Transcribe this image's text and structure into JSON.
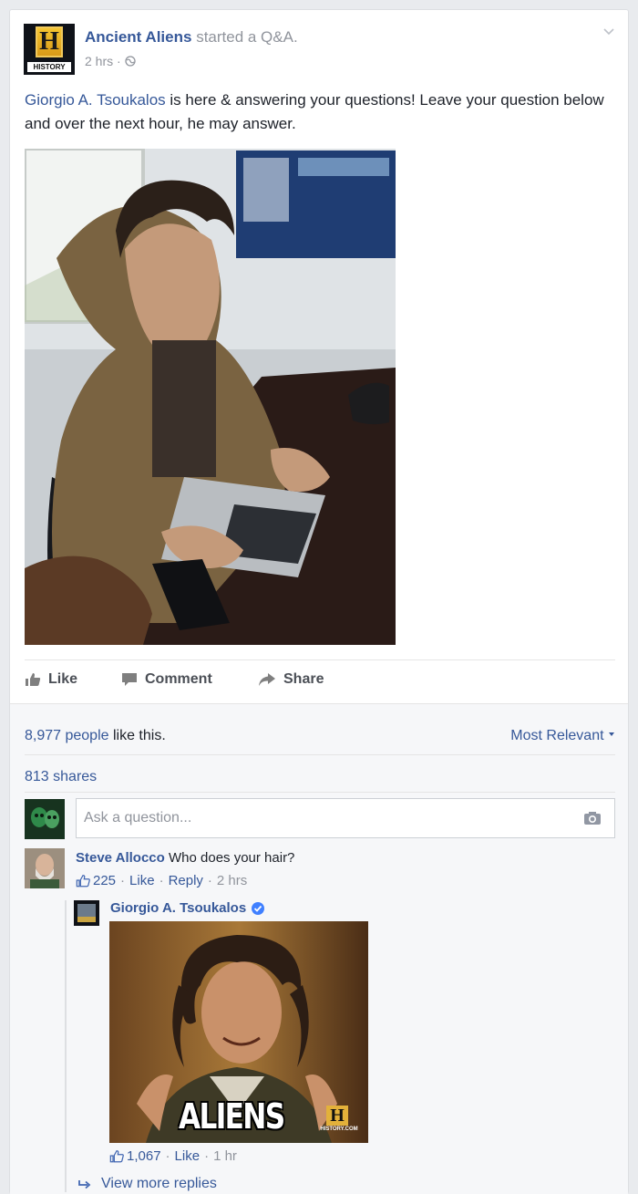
{
  "post": {
    "page_name": "Ancient Aliens",
    "verb": "started a Q&A.",
    "time": "2 hrs",
    "logo_text": "H",
    "logo_sub": "HISTORY",
    "mention": "Giorgio A. Tsoukalos",
    "body": " is here & answering your questions! Leave your question below and over the next hour, he may answer."
  },
  "actions": {
    "like": "Like",
    "comment": "Comment",
    "share": "Share"
  },
  "stats": {
    "likes_count": "8,977 people",
    "likes_suffix": " like this.",
    "sort_label": "Most Relevant",
    "shares": "813 shares"
  },
  "composer": {
    "placeholder": "Ask a question..."
  },
  "comment": {
    "author": "Steve Allocco",
    "text": " Who does your hair?",
    "like_count": "225",
    "like_label": "Like",
    "reply_label": "Reply",
    "time": "2 hrs"
  },
  "reply": {
    "author": "Giorgio A. Tsoukalos",
    "caption": "ALIENS",
    "watermark": "H",
    "watermark_sub": "HISTORY.COM",
    "like_count": "1,067",
    "like_label": "Like",
    "time": "1 hr",
    "view_more": "View more replies"
  },
  "colors": {
    "link": "#365899",
    "muted": "#90949c",
    "text": "#1d2129",
    "verified": "#4080ff"
  },
  "icons": [
    "chevron-down-icon",
    "globe-icon",
    "thumbs-up-icon",
    "comment-icon",
    "share-icon",
    "camera-icon",
    "verified-badge-icon",
    "reply-arrow-icon",
    "caret-down-icon"
  ]
}
